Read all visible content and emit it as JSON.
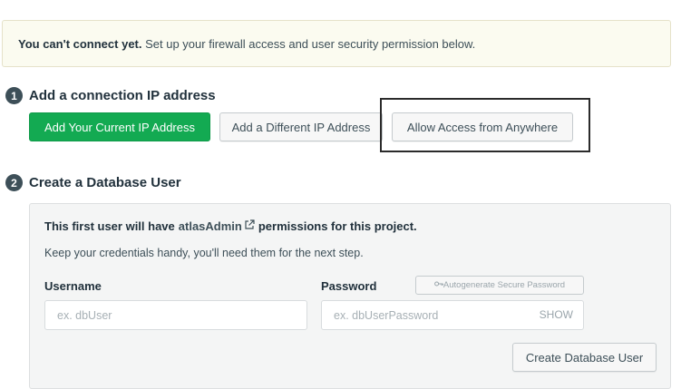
{
  "banner": {
    "bold_text": "You can't connect yet.",
    "text": " Set up your firewall access and user security permission below."
  },
  "step1": {
    "number": "1",
    "title": "Add a connection IP address",
    "buttons": {
      "add_current": "Add Your Current IP Address",
      "add_different": "Add a Different IP Address",
      "allow_anywhere": "Allow Access from Anywhere"
    }
  },
  "step2": {
    "number": "2",
    "title": "Create a Database User",
    "panel": {
      "intro_prefix": "This first user will have",
      "role": "atlasAdmin",
      "intro_suffix": "permissions for this project.",
      "subtext": "Keep your credentials handy, you'll need them for the next step.",
      "username_label": "Username",
      "username_placeholder": "ex. dbUser",
      "username_value": "",
      "password_label": "Password",
      "autogenerate_label": "Autogenerate Secure Password",
      "password_placeholder": "ex. dbUserPassword",
      "password_value": "",
      "show_label": "SHOW",
      "create_button": "Create Database User"
    }
  },
  "colors": {
    "primary_green": "#13aa52",
    "banner_bg": "#fbfbf0",
    "panel_bg": "#f4f5f5",
    "text_dark": "#21313c"
  },
  "icons": {
    "step_badge": "numbered-circle",
    "role_link": "external-link-icon",
    "autogenerate": "key-icon"
  }
}
